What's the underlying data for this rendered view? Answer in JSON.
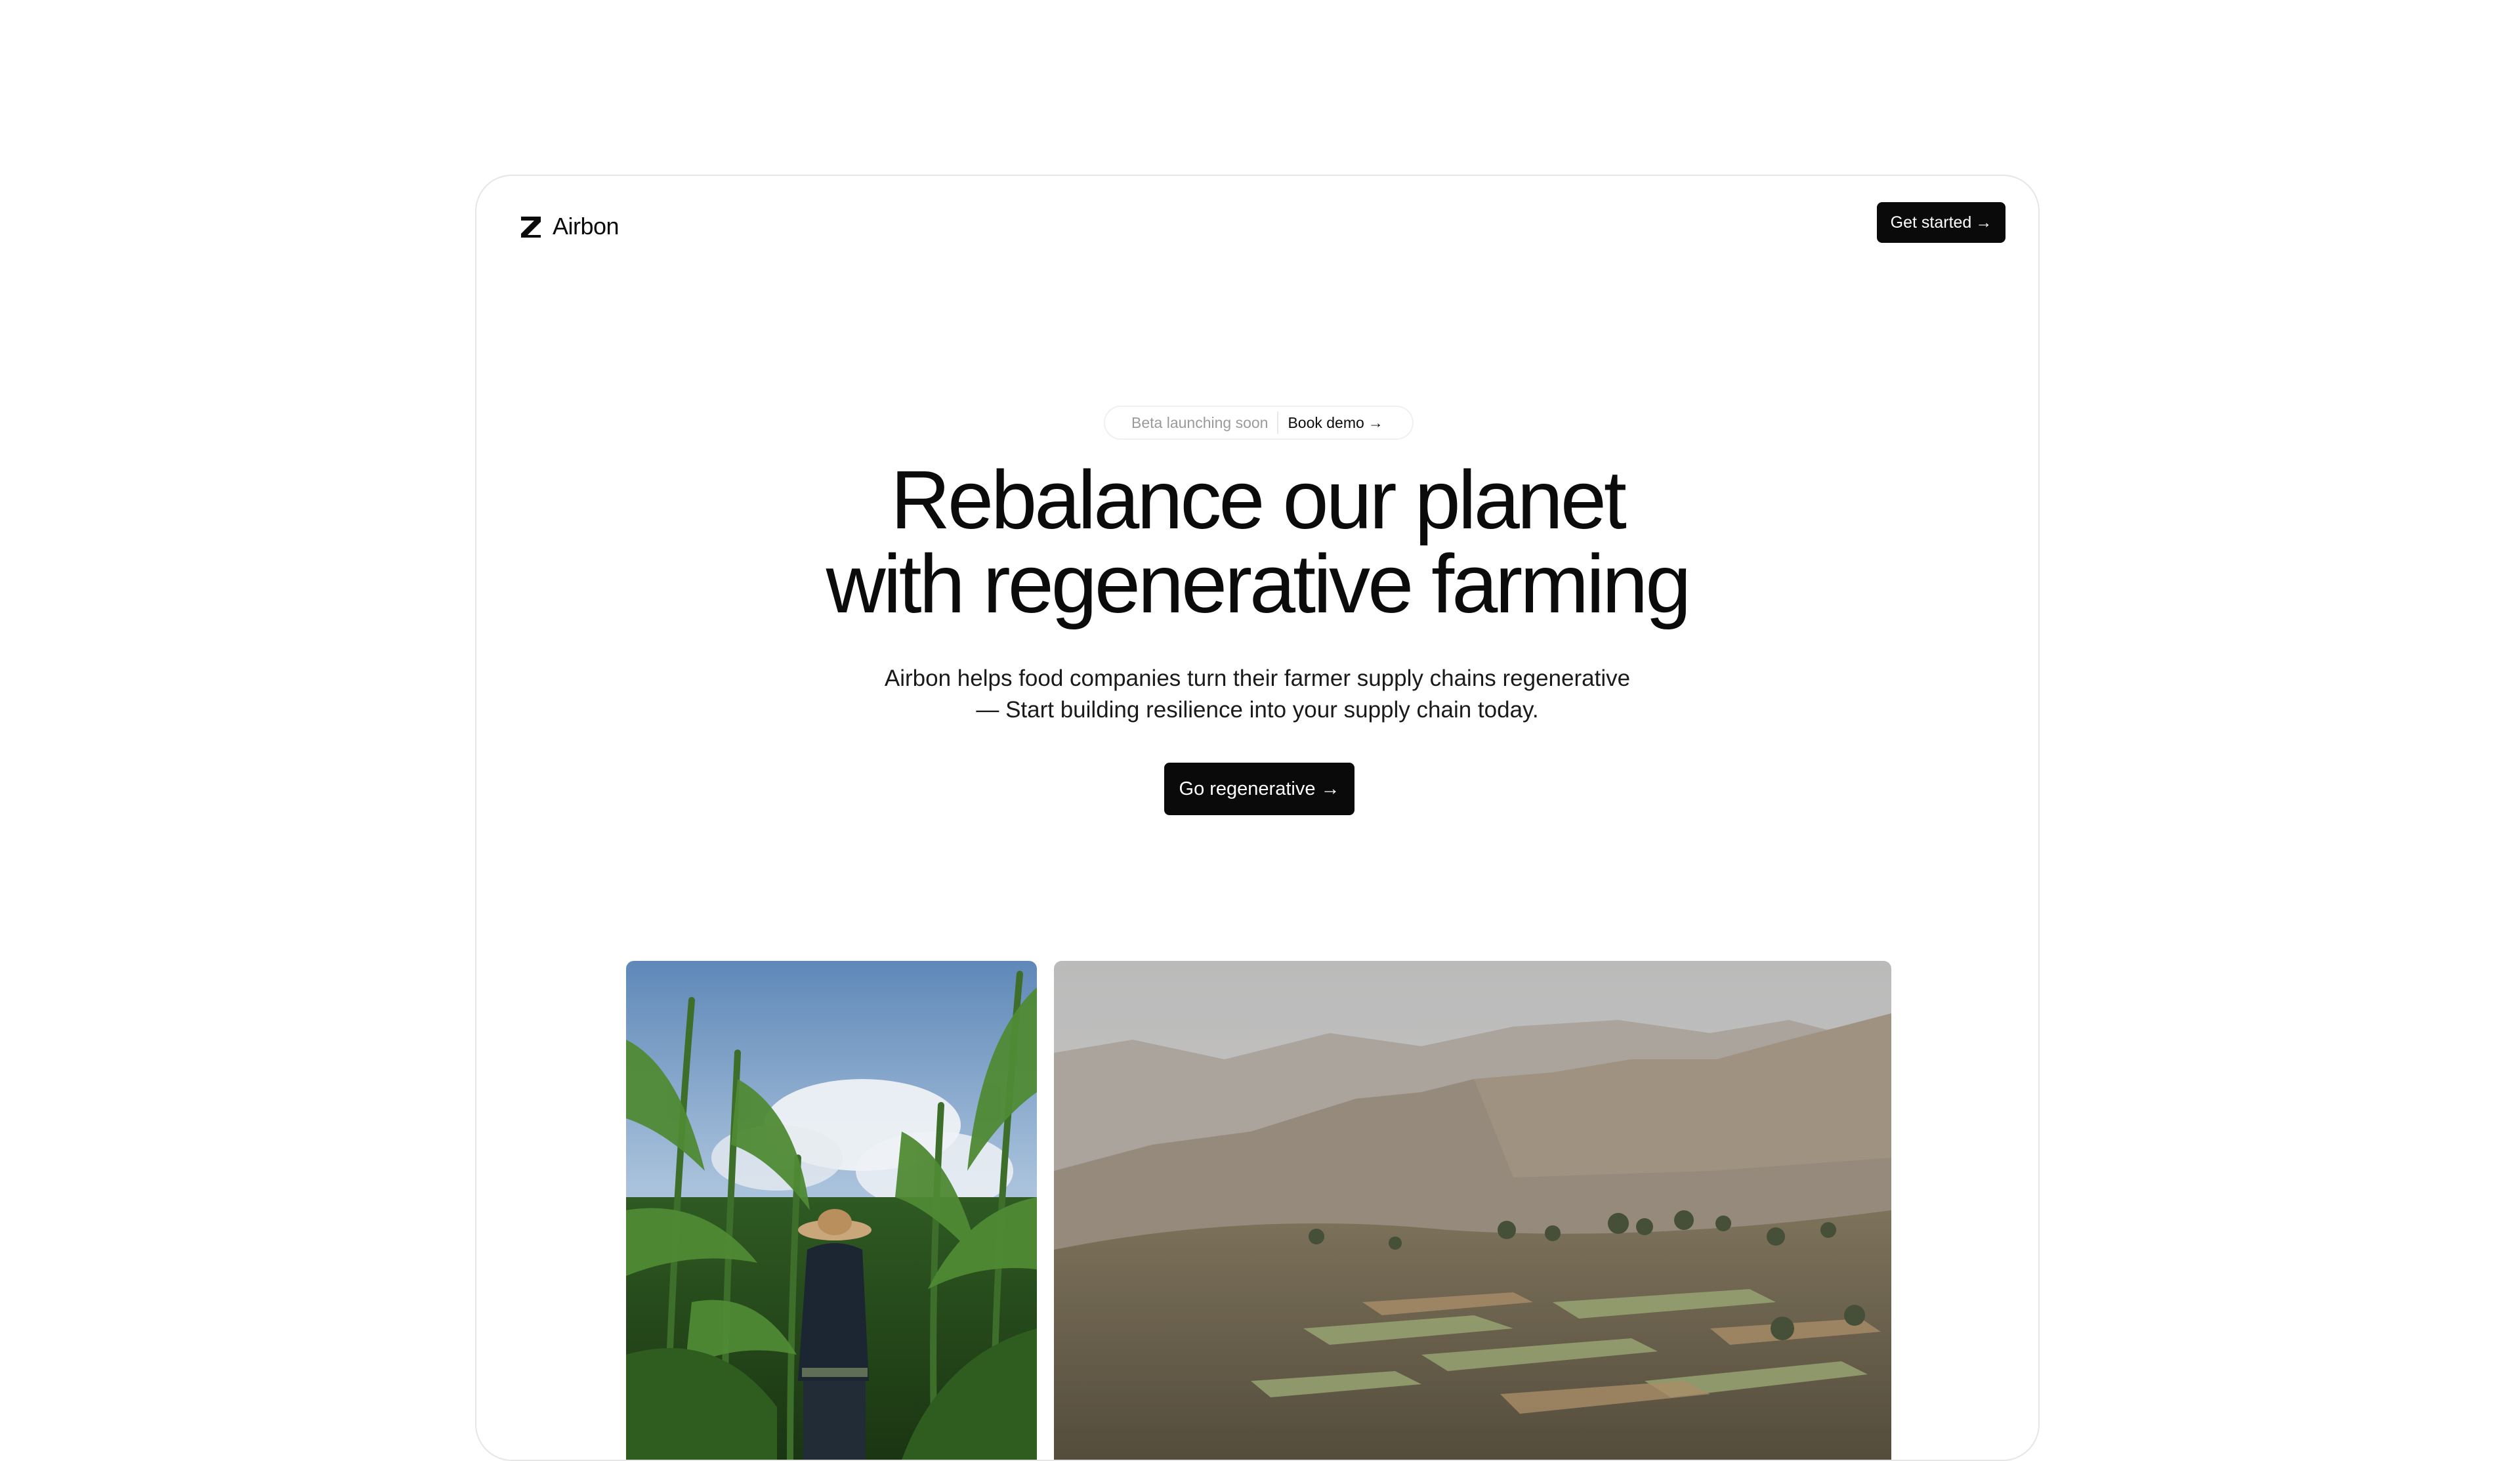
{
  "header": {
    "logo_icon": "airbon-logo-icon",
    "brand": "Airbon",
    "cta_label": "Get started",
    "cta_arrow": "→"
  },
  "announcement": {
    "status": "Beta launching soon",
    "link_label": "Book demo",
    "link_arrow": "→"
  },
  "hero": {
    "headline_line1": "Rebalance our planet",
    "headline_line2": "with regenerative farming",
    "subtext_line1": "Airbon helps food companies turn their farmer supply chains regenerative",
    "subtext_line2": "— Start building resilience into your supply chain today.",
    "cta_label": "Go regenerative",
    "cta_arrow": "→"
  },
  "images": [
    {
      "name": "farmer-cornfield-photo"
    },
    {
      "name": "terraced-valley-photo"
    }
  ],
  "colors": {
    "primary": "#0a0a0a",
    "background": "#ffffff",
    "muted_text": "#9a9a9a",
    "frame_border": "#e6e6e6"
  }
}
